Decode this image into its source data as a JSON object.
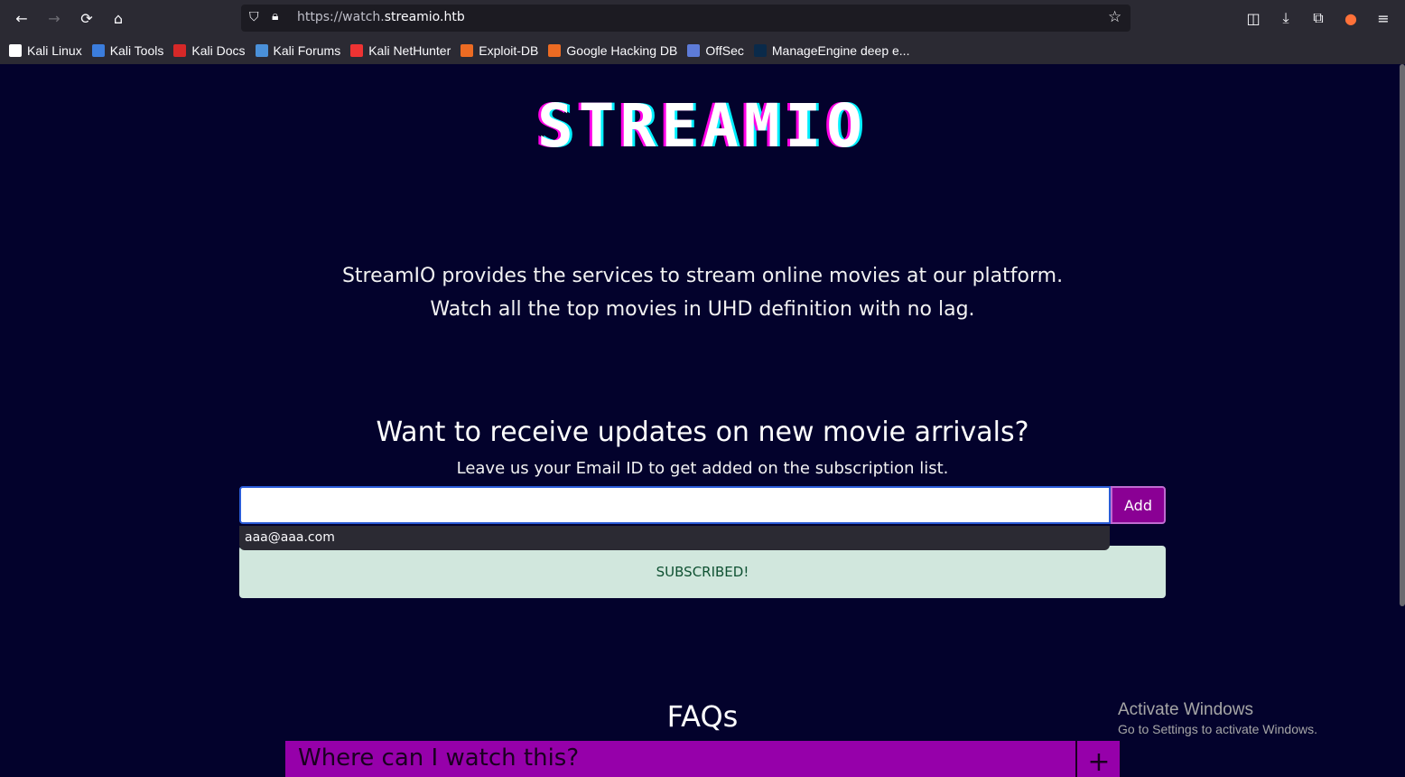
{
  "browser": {
    "url_prefix": "https://watch.",
    "url_domain": "streamio.htb",
    "bookmarks": [
      {
        "label": "Kali Linux",
        "icon": "kali-dragon-icon",
        "color": "#ffffff"
      },
      {
        "label": "Kali Tools",
        "icon": "kali-tools-icon",
        "color": "#3b7ddd"
      },
      {
        "label": "Kali Docs",
        "icon": "kali-docs-icon",
        "color": "#d62828"
      },
      {
        "label": "Kali Forums",
        "icon": "kali-forums-icon",
        "color": "#4a90d9"
      },
      {
        "label": "Kali NetHunter",
        "icon": "nethunter-icon",
        "color": "#e33"
      },
      {
        "label": "Exploit-DB",
        "icon": "exploit-db-icon",
        "color": "#ec6b23"
      },
      {
        "label": "Google Hacking DB",
        "icon": "ghdb-icon",
        "color": "#ec6b23"
      },
      {
        "label": "OffSec",
        "icon": "offsec-icon",
        "color": "#5d7bd8"
      },
      {
        "label": "ManageEngine deep e...",
        "icon": "manageengine-icon",
        "color": "#0a2a4a"
      }
    ]
  },
  "page": {
    "logo": "STREAMIO",
    "intro_line1": "StreamIO provides the services to stream online movies at our platform.",
    "intro_line2": "Watch all the top movies in UHD definition with no lag.",
    "updates_title": "Want to receive updates on new movie arrivals?",
    "updates_sub": "Leave us your Email ID to get added on the subscription list.",
    "email_value": "",
    "add_label": "Add",
    "autocomplete_entry": "aaa@aaa.com",
    "alert_text": "SUBSCRIBED!",
    "faq_title": "FAQs",
    "faq_items": [
      {
        "question": "Where can I watch this?",
        "toggle": "+"
      }
    ]
  },
  "os": {
    "watermark_title": "Activate Windows",
    "watermark_sub": "Go to Settings to activate Windows."
  }
}
